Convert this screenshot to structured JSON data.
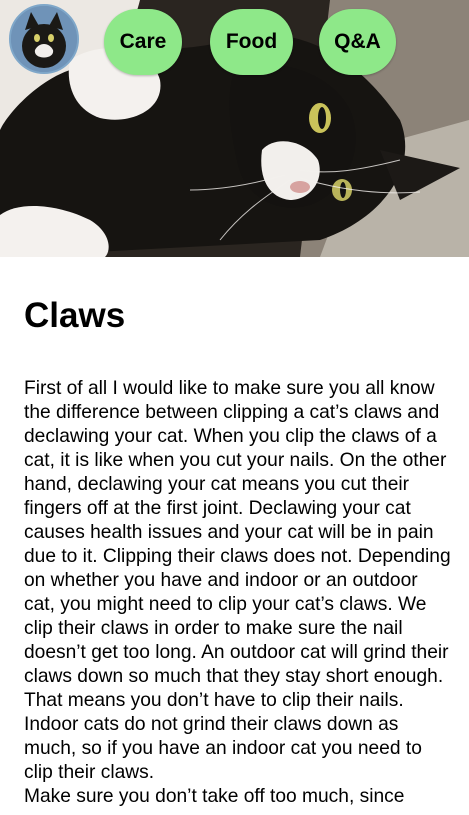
{
  "header": {
    "logo_alt": "cat avatar",
    "nav": [
      {
        "label": "Care"
      },
      {
        "label": "Food"
      },
      {
        "label": "Q&A"
      }
    ]
  },
  "hero": {
    "image": "cat-photo",
    "colors": {
      "fur_black": "#161411",
      "fur_white": "#f4f1ee",
      "carpet": "#b9b3a8",
      "eye": "#c9c25a"
    }
  },
  "article": {
    "title": "Claws",
    "paragraph_1": "First of all I would like to make sure you all know the difference between clipping a cat’s claws and declawing your cat. When you clip the claws of a cat, it is like when you cut your nails. On the other hand, declawing your cat means you cut their fingers off at the first joint. Declawing your cat causes health issues and your cat will be in pain due to it. Clipping their claws does not. Depending on whether you have and indoor or an outdoor cat, you might need to clip your cat’s claws. We clip their claws in order to make sure the nail doesn’t get too long. An outdoor cat will grind their claws down so much that they stay short enough. That means you don’t have to clip their nails. Indoor cats do not grind their claws down as much, so if you have an indoor cat you need to clip their claws.",
    "paragraph_2": "Make sure you don’t take off too much, since"
  },
  "colors": {
    "nav_button": "#8ee889",
    "text": "#000000",
    "background": "#ffffff"
  }
}
